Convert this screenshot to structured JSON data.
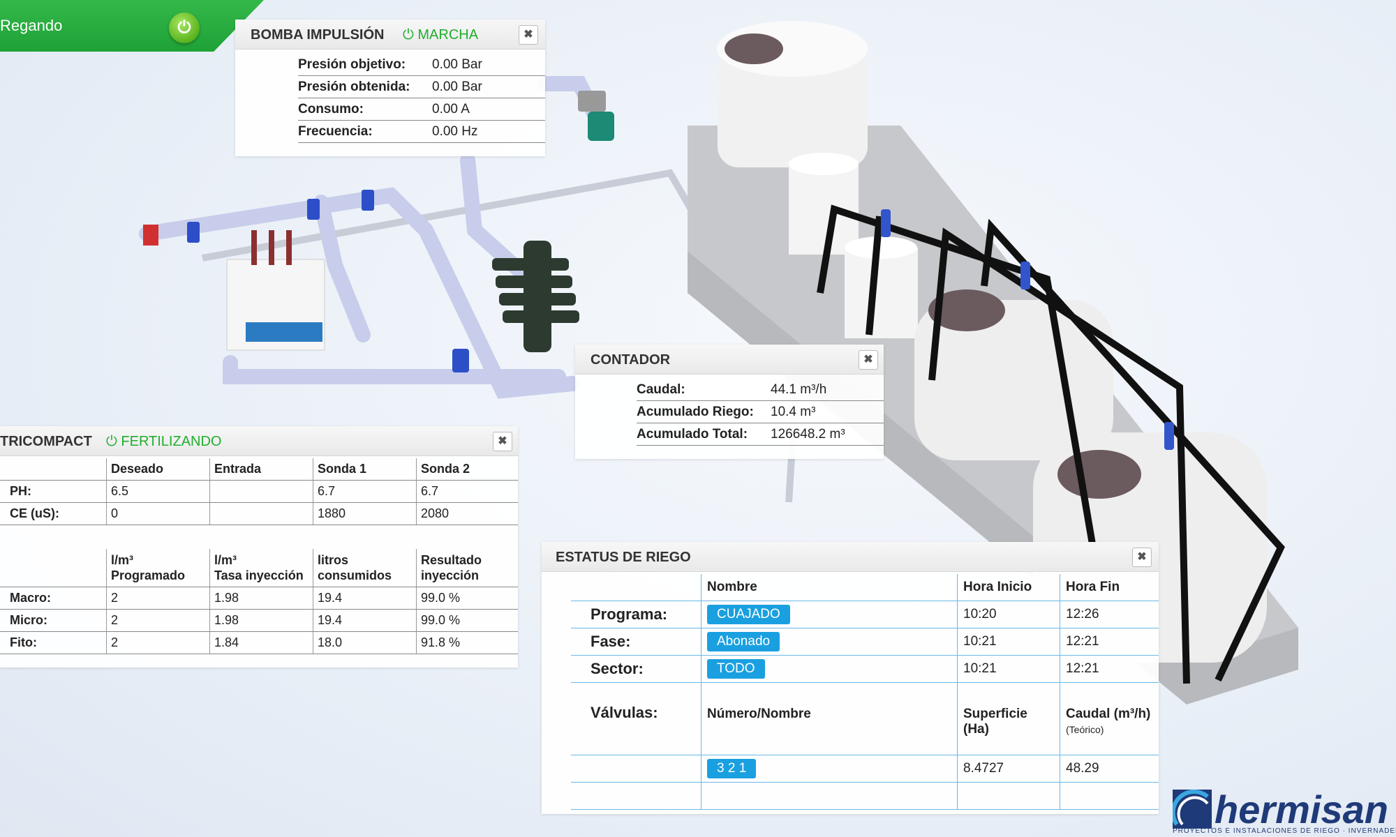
{
  "status": {
    "label": "Regando"
  },
  "bomba": {
    "title": "BOMBA IMPULSIÓN",
    "state": "MARCHA",
    "rows": [
      {
        "label": "Presión objetivo:",
        "value": "0.00 Bar"
      },
      {
        "label": "Presión obtenida:",
        "value": "0.00 Bar"
      },
      {
        "label": "Consumo:",
        "value": "0.00 A"
      },
      {
        "label": "Frecuencia:",
        "value": "0.00 Hz"
      }
    ]
  },
  "contador": {
    "title": "CONTADOR",
    "rows": [
      {
        "label": "Caudal:",
        "value": "44.1 m³/h"
      },
      {
        "label": "Acumulado Riego:",
        "value": "10.4 m³"
      },
      {
        "label": "Acumulado Total:",
        "value": "126648.2 m³"
      }
    ]
  },
  "nutricompact": {
    "title": "TRICOMPACT",
    "state": "FERTILIZANDO",
    "headers": [
      "Deseado",
      "Entrada",
      "Sonda 1",
      "Sonda 2"
    ],
    "rows": [
      {
        "label": "PH:",
        "cells": [
          "6.5",
          "",
          "6.7",
          "6.7"
        ]
      },
      {
        "label": "CE (uS):",
        "cells": [
          "0",
          "",
          "1880",
          "2080"
        ]
      }
    ],
    "headers2": [
      {
        "l1": "l/m³",
        "l2": "Programado"
      },
      {
        "l1": "l/m³",
        "l2": "Tasa inyección"
      },
      {
        "l1": "litros",
        "l2": "consumidos"
      },
      {
        "l1": "Resultado",
        "l2": "inyección"
      }
    ],
    "rows2": [
      {
        "label": "Macro:",
        "cells": [
          "2",
          "1.98",
          "19.4",
          "99.0 %"
        ]
      },
      {
        "label": "Micro:",
        "cells": [
          "2",
          "1.98",
          "19.4",
          "99.0 %"
        ]
      },
      {
        "label": "Fito:",
        "cells": [
          "2",
          "1.84",
          "18.0",
          "91.8 %"
        ]
      }
    ]
  },
  "riego": {
    "title": "ESTATUS DE RIEGO",
    "headers": [
      "Nombre",
      "Hora Inicio",
      "Hora Fin"
    ],
    "rows": [
      {
        "label": "Programa:",
        "name": "CUAJADO",
        "inicio": "10:20",
        "fin": "12:26"
      },
      {
        "label": "Fase:",
        "name": "Abonado",
        "inicio": "10:21",
        "fin": "12:21"
      },
      {
        "label": "Sector:",
        "name": "TODO",
        "inicio": "10:21",
        "fin": "12:21"
      }
    ],
    "valvulas_label": "Válvulas:",
    "valv_headers": [
      "Número/Nombre",
      "Superficie (Ha)",
      "Caudal (m³/h)"
    ],
    "valv_note": "(Teórico)",
    "valvulas": [
      {
        "numero": "3 2 1",
        "superficie": "8.4727",
        "caudal": "48.29"
      }
    ]
  },
  "logo": {
    "name": "hermisan",
    "tagline": "PROYECTOS E INSTALACIONES DE RIEGO · INVERNADEROS"
  },
  "colors": {
    "green": "#1fae2d",
    "accent": "#1aa0e0",
    "navy": "#1f3a78"
  }
}
